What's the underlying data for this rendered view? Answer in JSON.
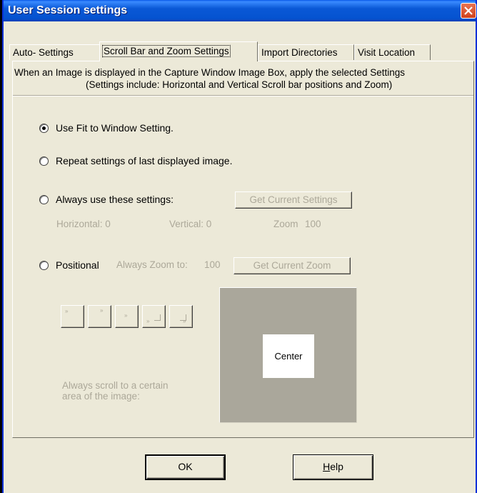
{
  "window": {
    "title": "User Session settings"
  },
  "tabs": [
    {
      "label": "Auto- Settings",
      "active": false
    },
    {
      "label": "Scroll Bar and Zoom Settings",
      "active": true
    },
    {
      "label": "Import Directories",
      "active": false
    },
    {
      "label": "Visit Location",
      "active": false
    }
  ],
  "panel": {
    "description_line1": "When an Image is displayed in the Capture Window Image Box, apply the selected Settings",
    "description_line2": "(Settings include: Horizontal and Vertical Scroll bar positions and Zoom)",
    "options": {
      "fit_to_window": "Use Fit to Window Setting.",
      "repeat_last": "Repeat settings of last displayed image.",
      "always_use": "Always use these settings:",
      "positional": "Positional"
    },
    "selected_option": "fit_to_window",
    "get_current_settings_label": "Get Current Settings",
    "horizontal_label": "Horizontal: 0",
    "vertical_label": "Vertical: 0",
    "zoom_label": "Zoom",
    "zoom_value": "100",
    "always_zoom_label": "Always Zoom to:",
    "always_zoom_value": "100",
    "get_current_zoom_label": "Get Current Zoom",
    "scroll_hint_line1": "Always scroll to a certain",
    "scroll_hint_line2": "area of the image:",
    "preview_center_label": "Center"
  },
  "footer": {
    "ok_label": "OK",
    "help_label": "Help"
  },
  "colors": {
    "titlebar": "#0553d0",
    "dialog_bg": "#ece9d8",
    "disabled_text": "#aca899",
    "preview_bg": "#aaa79b",
    "close_button": "#d0411c"
  }
}
